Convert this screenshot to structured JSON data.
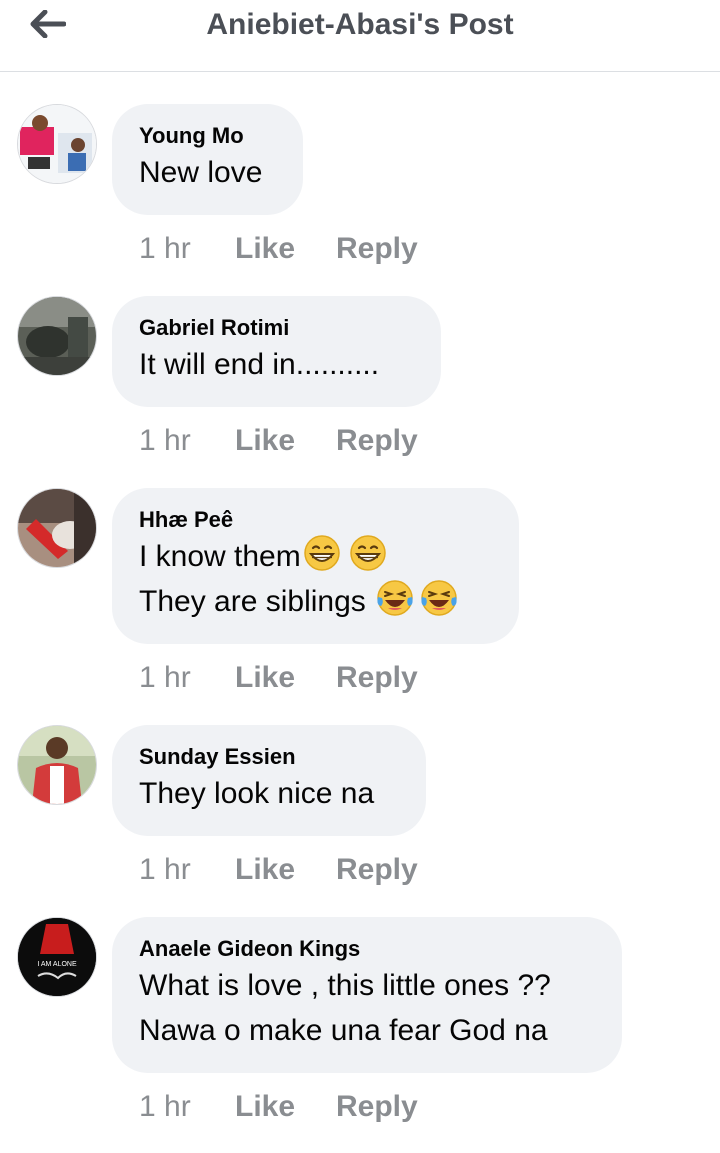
{
  "header": {
    "title": "Aniebiet-Abasi's Post",
    "back_icon": "arrow-left-icon"
  },
  "comments": [
    {
      "author": "Young Mo",
      "lines": [
        "New love"
      ],
      "time": "1 hr",
      "like_label": "Like",
      "reply_label": "Reply"
    },
    {
      "author": "Gabriel Rotimi",
      "lines": [
        "It will end in.........."
      ],
      "time": "1 hr",
      "like_label": "Like",
      "reply_label": "Reply"
    },
    {
      "author": "Hhæ Peê",
      "lines": [
        "I know them",
        "They are siblings "
      ],
      "time": "1 hr",
      "like_label": "Like",
      "reply_label": "Reply"
    },
    {
      "author": "Sunday Essien",
      "lines": [
        "They look nice na"
      ],
      "time": "1 hr",
      "like_label": "Like",
      "reply_label": "Reply"
    },
    {
      "author": "Anaele Gideon Kings",
      "lines": [
        "What is love , this little ones ??",
        "Nawa o make una fear God na"
      ],
      "time": "1 hr",
      "like_label": "Like",
      "reply_label": "Reply",
      "avatar_text": "I AM ALONE"
    }
  ],
  "colors": {
    "bubble": "#f0f2f5",
    "secondary_text": "#8a8d91",
    "title_text": "#4b4f56"
  }
}
